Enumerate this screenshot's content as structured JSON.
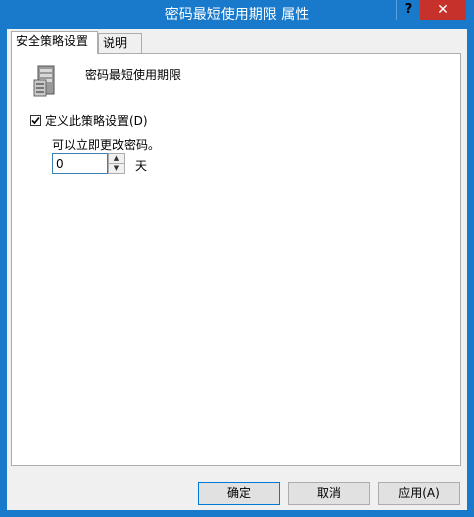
{
  "window": {
    "title": "密码最短使用期限 属性",
    "help_label": "?",
    "close_label": "✕"
  },
  "tabs": [
    {
      "label": "安全策略设置",
      "active": true
    },
    {
      "label": "说明",
      "active": false
    }
  ],
  "policy": {
    "icon": "server-policy-icon",
    "name": "密码最短使用期限"
  },
  "define_checkbox": {
    "label": "定义此策略设置(D)",
    "checked": true
  },
  "setting": {
    "hint": "可以立即更改密码。",
    "value": "0",
    "unit": "天"
  },
  "buttons": {
    "ok": "确定",
    "cancel": "取消",
    "apply": "应用(A)"
  },
  "colors": {
    "titlebar": "#1979ca",
    "close": "#c7312b",
    "focus_border": "#0078d7"
  }
}
